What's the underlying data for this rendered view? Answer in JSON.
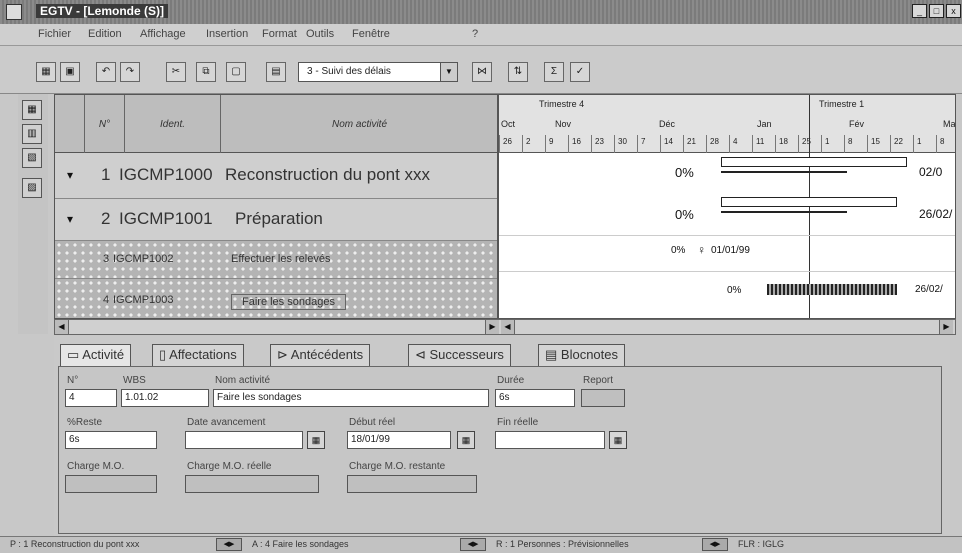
{
  "window": {
    "title": "EGTV - [Lemonde (S)]",
    "min": "_",
    "max": "□",
    "close": "x"
  },
  "menu": [
    "Fichier",
    "Edition",
    "Affichage",
    "Insertion",
    "Format",
    "Outils",
    "Fenêtre",
    "?"
  ],
  "toolbar": {
    "view_value": "3 - Suivi des délais",
    "sigma": "Σ"
  },
  "grid": {
    "headers": {
      "num": "N°",
      "code": "Ident.",
      "name": "Nom activité"
    },
    "rows": [
      {
        "num": "1",
        "code": "IGCMP1000",
        "name": "Reconstruction du pont xxx"
      },
      {
        "num": "2",
        "code": "IGCMP1001",
        "name": "Préparation"
      },
      {
        "num": "3",
        "code": "IGCMP1002",
        "name": "Effectuer les relevés"
      },
      {
        "num": "4",
        "code": "IGCMP1003",
        "name": "Faire les sondages"
      }
    ]
  },
  "gantt": {
    "quarters": [
      "Trimestre 4",
      "Trimestre 1"
    ],
    "months": [
      "Oct",
      "Nov",
      "Déc",
      "Jan",
      "Fév",
      "Ma"
    ],
    "days": [
      "26",
      "2",
      "9",
      "16",
      "23",
      "30",
      "7",
      "14",
      "21",
      "28",
      "4",
      "11",
      "18",
      "25",
      "1",
      "8",
      "15",
      "22",
      "1",
      "8"
    ],
    "rows": [
      {
        "pct": "0%",
        "end": "02/0"
      },
      {
        "pct": "0%",
        "end": "26/02/"
      },
      {
        "pct": "0%",
        "milestone": "01/01/99"
      },
      {
        "pct": "0%",
        "end": "26/02/"
      }
    ]
  },
  "tabs": [
    "Activité",
    "Affectations",
    "Antécédents",
    "Successeurs",
    "Blocnotes"
  ],
  "form": {
    "num_label": "N°",
    "num_value": "4",
    "wbs_label": "WBS",
    "wbs_value": "1.01.02",
    "name_label": "Nom activité",
    "name_value": "Faire les sondages",
    "duree_label": "Durée",
    "duree_value": "6s",
    "report_label": "Report",
    "reste_label": "%Reste",
    "reste_value": "6s",
    "date_av_label": "Date avancement",
    "debut_label": "Début réel",
    "debut_value": "18/01/99",
    "fin_label": "Fin réelle",
    "charge_label": "Charge M.O.",
    "charge_reelle_label": "Charge M.O. réelle",
    "charge_restante_label": "Charge M.O. restante"
  },
  "status": {
    "s1": "P : 1 Reconstruction du pont xxx",
    "s2": "A : 4 Faire les sondages",
    "s3": "R : 1 Personnes : Prévisionnelles",
    "s4": "FLR : IGLG"
  }
}
